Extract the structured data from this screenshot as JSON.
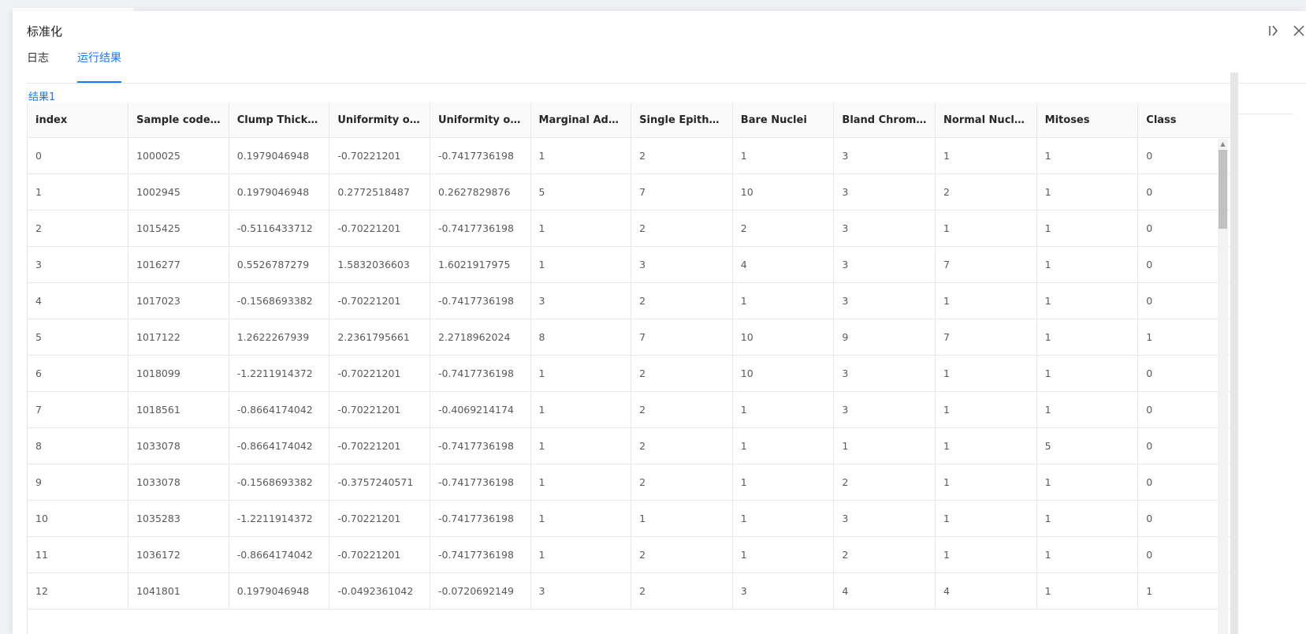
{
  "dialog": {
    "title": "标准化"
  },
  "tabs": [
    {
      "label": "日志",
      "active": false
    },
    {
      "label": "运行结果",
      "active": true
    }
  ],
  "subtabs": [
    {
      "label": "结果1",
      "active": true
    }
  ],
  "icons": {
    "collapse": "collapse-right-icon",
    "close": "close-icon",
    "scroll_up": "scroll-up-arrow-icon"
  },
  "colors": {
    "accent": "#1677ff",
    "header_bg": "#fafafa",
    "border": "#e8e8e8"
  },
  "table": {
    "columns": [
      "index",
      "Sample code n...",
      "Clump Thickness",
      "Uniformity of ...",
      "Uniformity of ...",
      "Marginal Adhe...",
      "Single Epitheli...",
      "Bare Nuclei",
      "Bland Chromatin",
      "Normal Nucleoli",
      "Mitoses",
      "Class"
    ],
    "rows": [
      [
        "0",
        "1000025",
        "0.1979046948",
        "-0.70221201",
        "-0.7417736198",
        "1",
        "2",
        "1",
        "3",
        "1",
        "1",
        "0"
      ],
      [
        "1",
        "1002945",
        "0.1979046948",
        "0.2772518487",
        "0.2627829876",
        "5",
        "7",
        "10",
        "3",
        "2",
        "1",
        "0"
      ],
      [
        "2",
        "1015425",
        "-0.5116433712",
        "-0.70221201",
        "-0.7417736198",
        "1",
        "2",
        "2",
        "3",
        "1",
        "1",
        "0"
      ],
      [
        "3",
        "1016277",
        "0.5526787279",
        "1.5832036603",
        "1.6021917975",
        "1",
        "3",
        "4",
        "3",
        "7",
        "1",
        "0"
      ],
      [
        "4",
        "1017023",
        "-0.1568693382",
        "-0.70221201",
        "-0.7417736198",
        "3",
        "2",
        "1",
        "3",
        "1",
        "1",
        "0"
      ],
      [
        "5",
        "1017122",
        "1.2622267939",
        "2.2361795661",
        "2.2718962024",
        "8",
        "7",
        "10",
        "9",
        "7",
        "1",
        "1"
      ],
      [
        "6",
        "1018099",
        "-1.2211914372",
        "-0.70221201",
        "-0.7417736198",
        "1",
        "2",
        "10",
        "3",
        "1",
        "1",
        "0"
      ],
      [
        "7",
        "1018561",
        "-0.8664174042",
        "-0.70221201",
        "-0.4069214174",
        "1",
        "2",
        "1",
        "3",
        "1",
        "1",
        "0"
      ],
      [
        "8",
        "1033078",
        "-0.8664174042",
        "-0.70221201",
        "-0.7417736198",
        "1",
        "2",
        "1",
        "1",
        "1",
        "5",
        "0"
      ],
      [
        "9",
        "1033078",
        "-0.1568693382",
        "-0.3757240571",
        "-0.7417736198",
        "1",
        "2",
        "1",
        "2",
        "1",
        "1",
        "0"
      ],
      [
        "10",
        "1035283",
        "-1.2211914372",
        "-0.70221201",
        "-0.7417736198",
        "1",
        "1",
        "1",
        "3",
        "1",
        "1",
        "0"
      ],
      [
        "11",
        "1036172",
        "-0.8664174042",
        "-0.70221201",
        "-0.7417736198",
        "1",
        "2",
        "1",
        "2",
        "1",
        "1",
        "0"
      ],
      [
        "12",
        "1041801",
        "0.1979046948",
        "-0.0492361042",
        "-0.0720692149",
        "3",
        "2",
        "3",
        "4",
        "4",
        "1",
        "1"
      ]
    ]
  }
}
